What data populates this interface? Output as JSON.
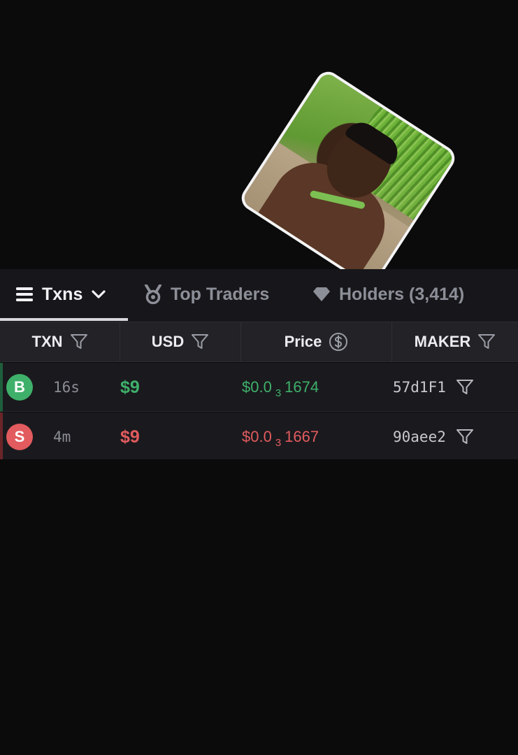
{
  "tabs": [
    {
      "label": "Txns",
      "icon": "list-icon",
      "active": true
    },
    {
      "label": "Top Traders",
      "icon": "medal-icon",
      "active": false
    },
    {
      "label": "Holders (3,414)",
      "icon": "diamond-icon",
      "active": false
    }
  ],
  "columns": {
    "txn": "TXN",
    "usd": "USD",
    "price": "Price",
    "maker": "MAKER"
  },
  "rows": [
    {
      "type": "B",
      "side": "buy",
      "age": "16s",
      "usd": "$9",
      "price_prefix": "$0.0",
      "price_zeros": "3",
      "price_digits": "1674",
      "maker": "57d1F1"
    },
    {
      "type": "S",
      "side": "sell",
      "age": "4m",
      "usd": "$9",
      "price_prefix": "$0.0",
      "price_zeros": "3",
      "price_digits": "1667",
      "maker": "90aee2"
    }
  ],
  "colors": {
    "background": "#0b0b0c",
    "buy": "#3fb06a",
    "sell": "#e25b5e",
    "muted": "#8d8f98"
  }
}
